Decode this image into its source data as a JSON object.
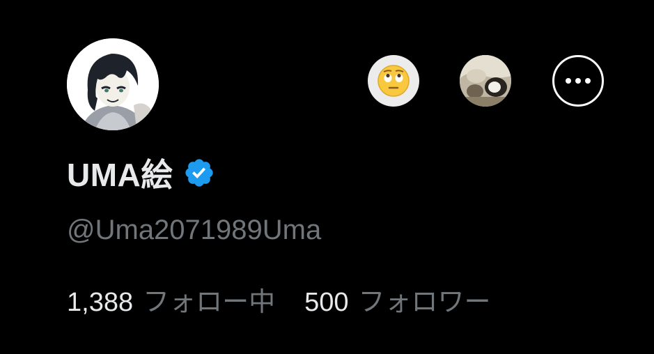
{
  "profile": {
    "display_name": "UMA絵",
    "handle": "@Uma2071989Uma",
    "verified": true,
    "avatar": "anime-character-avatar"
  },
  "actions": {
    "reaction_icon": "face-with-rolling-eyes-emoji",
    "media_icon": "photo-thumbnail",
    "more_icon": "more-options-icon"
  },
  "stats": {
    "following_count": "1,388",
    "following_label": "フォロー中",
    "followers_count": "500",
    "followers_label": "フォロワー"
  },
  "colors": {
    "background": "#000000",
    "primary_text": "#e7e9ea",
    "secondary_text": "#71767b",
    "verified_blue": "#1d9bf0"
  }
}
